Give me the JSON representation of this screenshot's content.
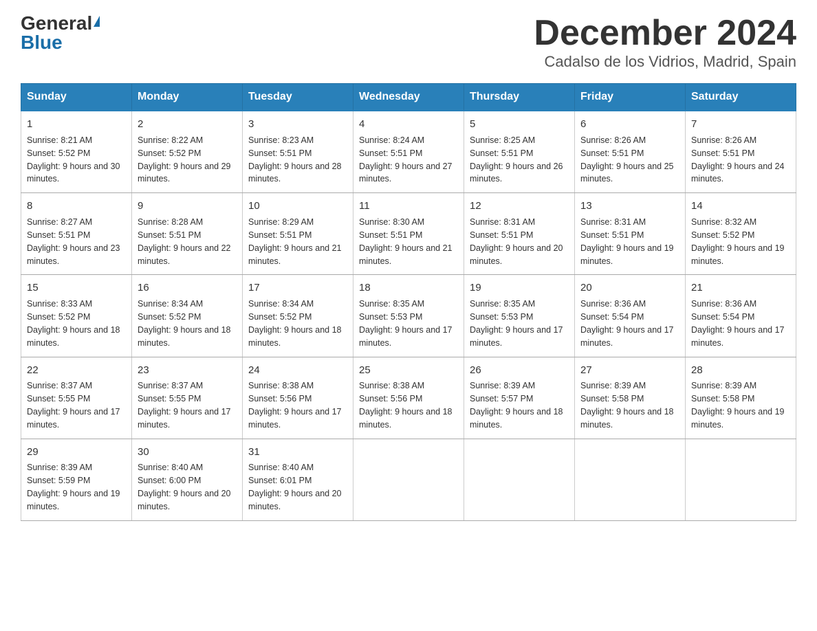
{
  "header": {
    "logo_general": "General",
    "logo_blue": "Blue",
    "title": "December 2024",
    "subtitle": "Cadalso de los Vidrios, Madrid, Spain"
  },
  "days_of_week": [
    "Sunday",
    "Monday",
    "Tuesday",
    "Wednesday",
    "Thursday",
    "Friday",
    "Saturday"
  ],
  "weeks": [
    [
      {
        "num": "1",
        "sunrise": "8:21 AM",
        "sunset": "5:52 PM",
        "daylight": "9 hours and 30 minutes."
      },
      {
        "num": "2",
        "sunrise": "8:22 AM",
        "sunset": "5:52 PM",
        "daylight": "9 hours and 29 minutes."
      },
      {
        "num": "3",
        "sunrise": "8:23 AM",
        "sunset": "5:51 PM",
        "daylight": "9 hours and 28 minutes."
      },
      {
        "num": "4",
        "sunrise": "8:24 AM",
        "sunset": "5:51 PM",
        "daylight": "9 hours and 27 minutes."
      },
      {
        "num": "5",
        "sunrise": "8:25 AM",
        "sunset": "5:51 PM",
        "daylight": "9 hours and 26 minutes."
      },
      {
        "num": "6",
        "sunrise": "8:26 AM",
        "sunset": "5:51 PM",
        "daylight": "9 hours and 25 minutes."
      },
      {
        "num": "7",
        "sunrise": "8:26 AM",
        "sunset": "5:51 PM",
        "daylight": "9 hours and 24 minutes."
      }
    ],
    [
      {
        "num": "8",
        "sunrise": "8:27 AM",
        "sunset": "5:51 PM",
        "daylight": "9 hours and 23 minutes."
      },
      {
        "num": "9",
        "sunrise": "8:28 AM",
        "sunset": "5:51 PM",
        "daylight": "9 hours and 22 minutes."
      },
      {
        "num": "10",
        "sunrise": "8:29 AM",
        "sunset": "5:51 PM",
        "daylight": "9 hours and 21 minutes."
      },
      {
        "num": "11",
        "sunrise": "8:30 AM",
        "sunset": "5:51 PM",
        "daylight": "9 hours and 21 minutes."
      },
      {
        "num": "12",
        "sunrise": "8:31 AM",
        "sunset": "5:51 PM",
        "daylight": "9 hours and 20 minutes."
      },
      {
        "num": "13",
        "sunrise": "8:31 AM",
        "sunset": "5:51 PM",
        "daylight": "9 hours and 19 minutes."
      },
      {
        "num": "14",
        "sunrise": "8:32 AM",
        "sunset": "5:52 PM",
        "daylight": "9 hours and 19 minutes."
      }
    ],
    [
      {
        "num": "15",
        "sunrise": "8:33 AM",
        "sunset": "5:52 PM",
        "daylight": "9 hours and 18 minutes."
      },
      {
        "num": "16",
        "sunrise": "8:34 AM",
        "sunset": "5:52 PM",
        "daylight": "9 hours and 18 minutes."
      },
      {
        "num": "17",
        "sunrise": "8:34 AM",
        "sunset": "5:52 PM",
        "daylight": "9 hours and 18 minutes."
      },
      {
        "num": "18",
        "sunrise": "8:35 AM",
        "sunset": "5:53 PM",
        "daylight": "9 hours and 17 minutes."
      },
      {
        "num": "19",
        "sunrise": "8:35 AM",
        "sunset": "5:53 PM",
        "daylight": "9 hours and 17 minutes."
      },
      {
        "num": "20",
        "sunrise": "8:36 AM",
        "sunset": "5:54 PM",
        "daylight": "9 hours and 17 minutes."
      },
      {
        "num": "21",
        "sunrise": "8:36 AM",
        "sunset": "5:54 PM",
        "daylight": "9 hours and 17 minutes."
      }
    ],
    [
      {
        "num": "22",
        "sunrise": "8:37 AM",
        "sunset": "5:55 PM",
        "daylight": "9 hours and 17 minutes."
      },
      {
        "num": "23",
        "sunrise": "8:37 AM",
        "sunset": "5:55 PM",
        "daylight": "9 hours and 17 minutes."
      },
      {
        "num": "24",
        "sunrise": "8:38 AM",
        "sunset": "5:56 PM",
        "daylight": "9 hours and 17 minutes."
      },
      {
        "num": "25",
        "sunrise": "8:38 AM",
        "sunset": "5:56 PM",
        "daylight": "9 hours and 18 minutes."
      },
      {
        "num": "26",
        "sunrise": "8:39 AM",
        "sunset": "5:57 PM",
        "daylight": "9 hours and 18 minutes."
      },
      {
        "num": "27",
        "sunrise": "8:39 AM",
        "sunset": "5:58 PM",
        "daylight": "9 hours and 18 minutes."
      },
      {
        "num": "28",
        "sunrise": "8:39 AM",
        "sunset": "5:58 PM",
        "daylight": "9 hours and 19 minutes."
      }
    ],
    [
      {
        "num": "29",
        "sunrise": "8:39 AM",
        "sunset": "5:59 PM",
        "daylight": "9 hours and 19 minutes."
      },
      {
        "num": "30",
        "sunrise": "8:40 AM",
        "sunset": "6:00 PM",
        "daylight": "9 hours and 20 minutes."
      },
      {
        "num": "31",
        "sunrise": "8:40 AM",
        "sunset": "6:01 PM",
        "daylight": "9 hours and 20 minutes."
      },
      null,
      null,
      null,
      null
    ]
  ]
}
